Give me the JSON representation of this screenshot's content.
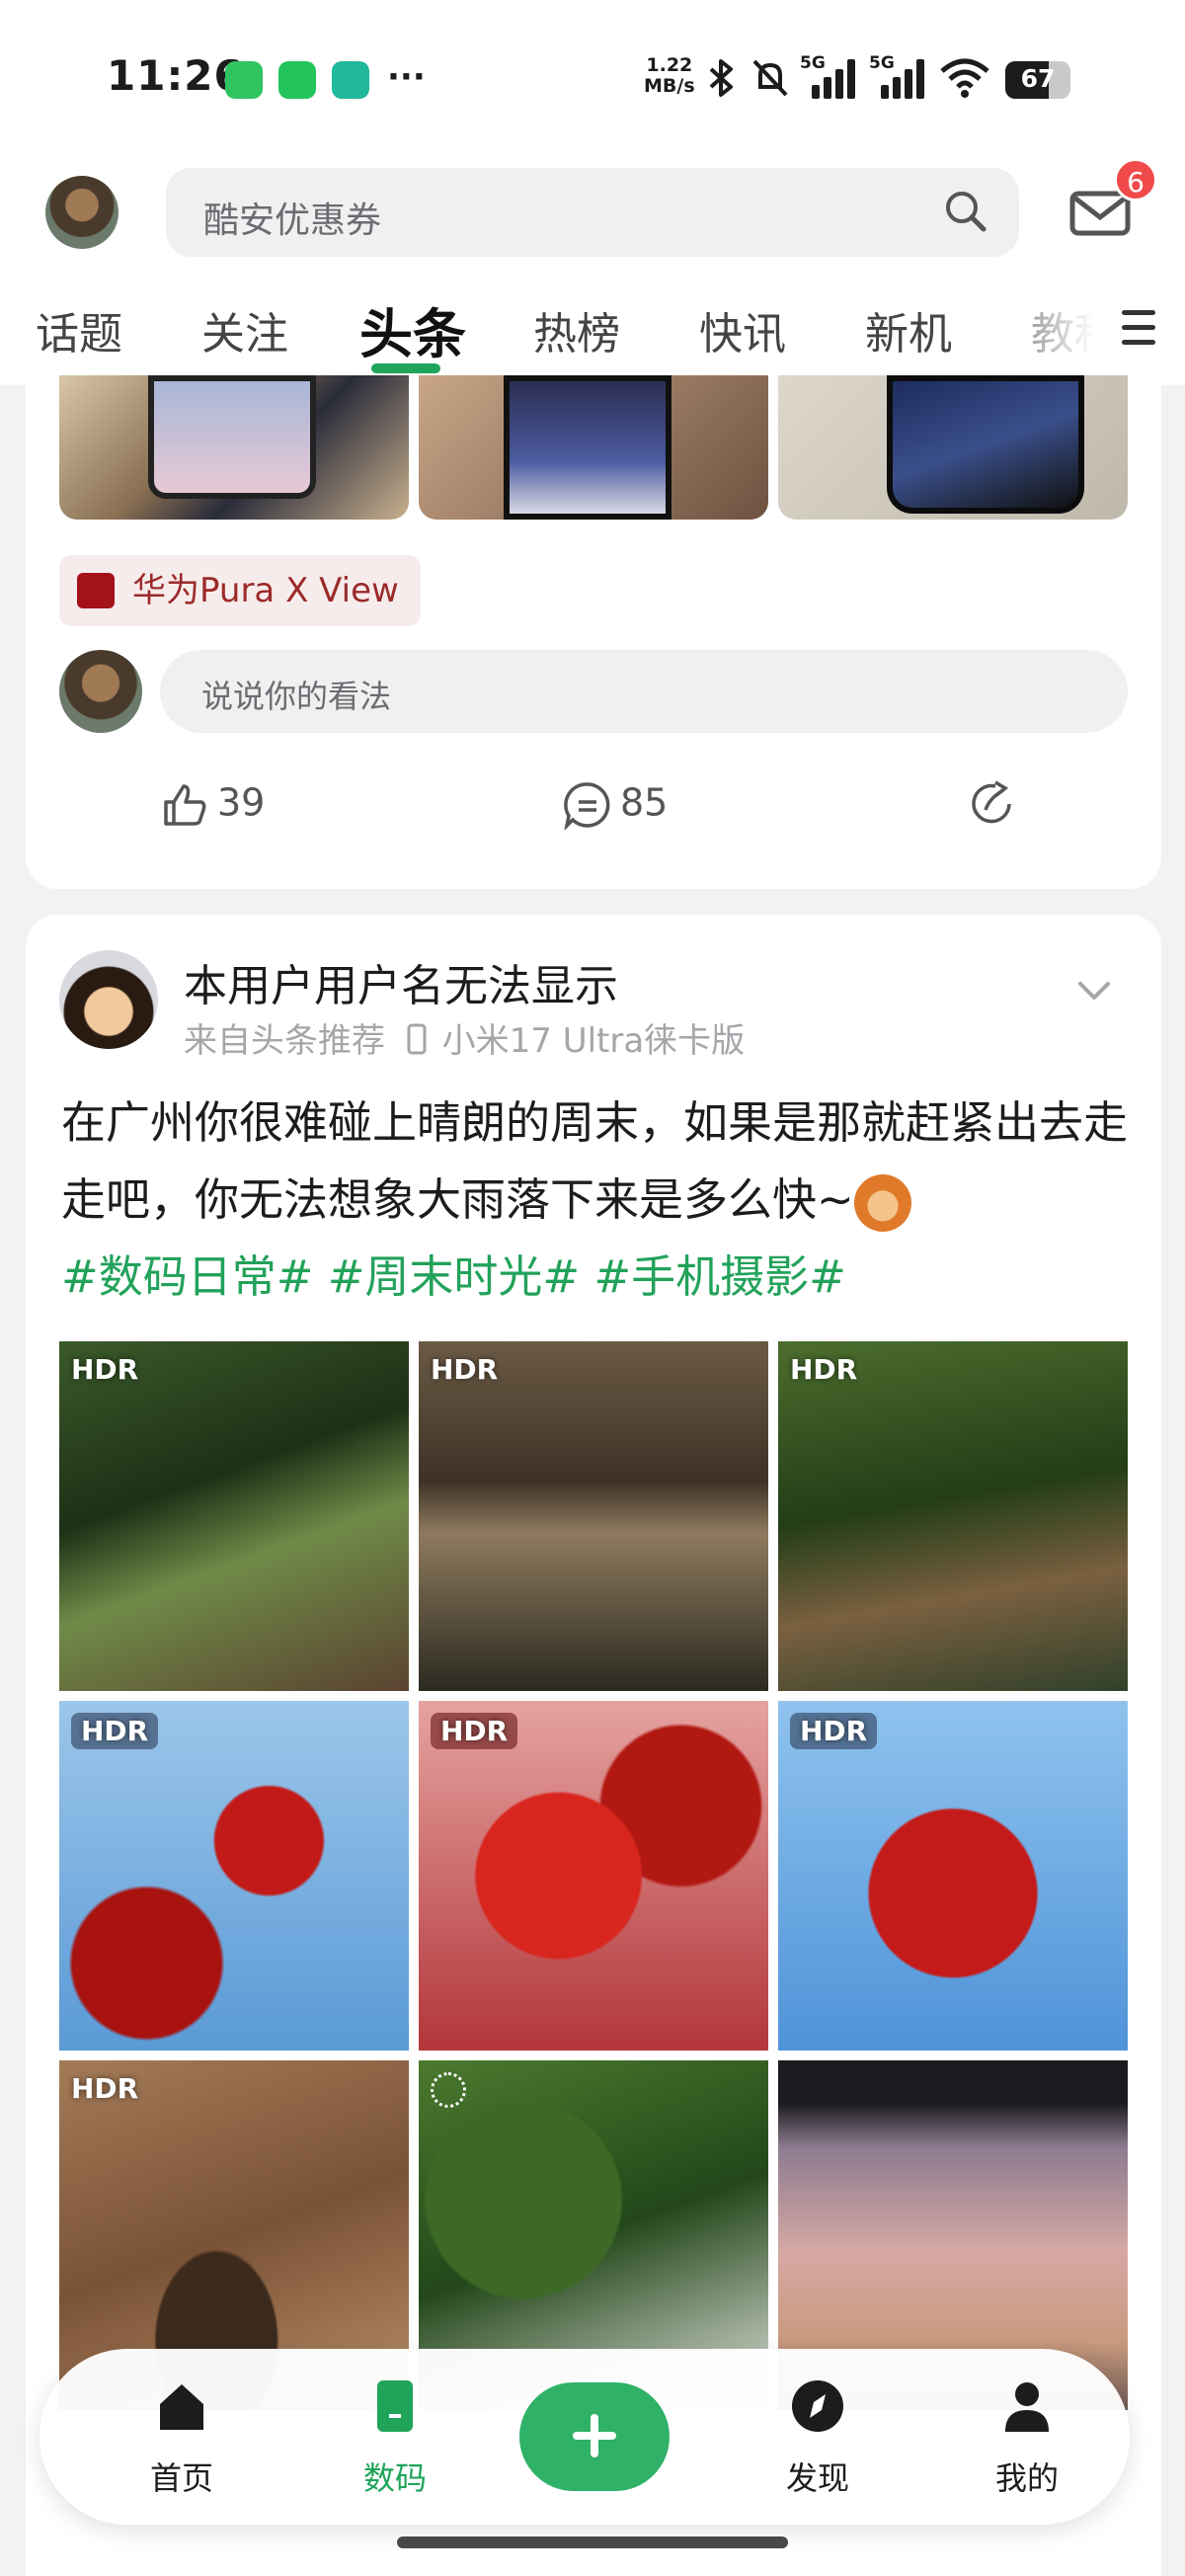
{
  "status_bar": {
    "time": "11:26",
    "network_speed_value": "1.22",
    "network_speed_unit": "MB/s",
    "signal1_label": "5G",
    "signal2_label": "5G",
    "battery": "67"
  },
  "header": {
    "search_placeholder": "酷安优惠券",
    "message_badge": "6",
    "tabs": [
      {
        "label": "话题"
      },
      {
        "label": "关注"
      },
      {
        "label": "头条"
      },
      {
        "label": "热榜"
      },
      {
        "label": "快讯"
      },
      {
        "label": "新机"
      },
      {
        "label": "教程"
      }
    ],
    "active_tab": "头条"
  },
  "card1": {
    "topic": "华为Pura X View",
    "comment_placeholder": "说说你的看法",
    "likes": "39",
    "comments": "85"
  },
  "card2": {
    "author": "本用户用户名无法显示",
    "source": "来自头条推荐",
    "device": "小米17 Ultra徕卡版",
    "text": "在广州你很难碰上晴朗的周末，如果是那就赶紧出去走走吧，你无法想象大雨落下来是多么快~",
    "hashtags": "#数码日常# #周末时光# #手机摄影#",
    "image_badges": [
      "HDR",
      "HDR",
      "HDR",
      "HDR",
      "HDR",
      "HDR",
      "HDR",
      "",
      ""
    ]
  },
  "bottom_nav": {
    "items": [
      {
        "label": "首页"
      },
      {
        "label": "数码"
      },
      {
        "label": "发现"
      },
      {
        "label": "我的"
      }
    ],
    "active": "数码"
  },
  "colors": {
    "accent": "#1fa45a",
    "badge": "#f04a4a",
    "topic_text": "#9c2a2a"
  }
}
